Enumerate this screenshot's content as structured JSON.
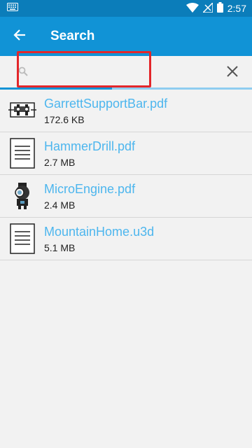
{
  "status_bar": {
    "time": "2:57",
    "icons": [
      "keyboard-icon",
      "wifi-icon",
      "no-signal-icon",
      "battery-icon"
    ]
  },
  "app_bar": {
    "title": "Search",
    "back_icon": "arrow-left-icon"
  },
  "search": {
    "value": "",
    "placeholder": "",
    "search_icon": "search-icon",
    "clear_icon": "close-icon"
  },
  "files": [
    {
      "name": "GarrettSupportBar.pdf",
      "size": "172.6 KB",
      "thumb": "cad-part-thumbnail"
    },
    {
      "name": "HammerDrill.pdf",
      "size": "2.7 MB",
      "thumb": "document-icon"
    },
    {
      "name": "MicroEngine.pdf",
      "size": "2.4 MB",
      "thumb": "engine-thumbnail"
    },
    {
      "name": "MountainHome.u3d",
      "size": "5.1 MB",
      "thumb": "document-icon"
    }
  ],
  "colors": {
    "status_bar": "#0b7dba",
    "app_bar": "#1193d6",
    "file_name": "#4db6ee",
    "highlight": "#e3262a"
  }
}
